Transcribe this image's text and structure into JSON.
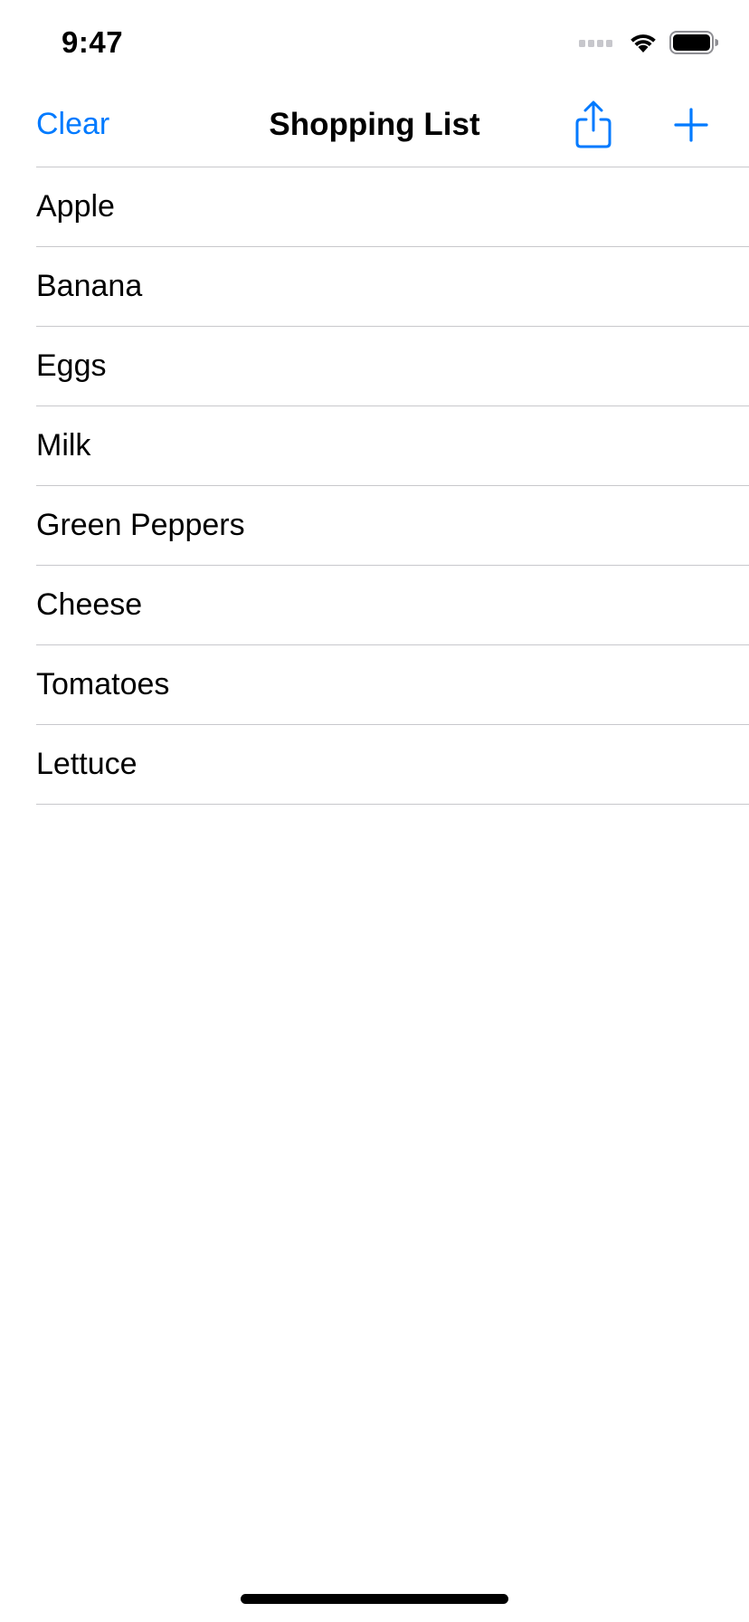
{
  "status_bar": {
    "time": "9:47"
  },
  "nav": {
    "clear_label": "Clear",
    "title": "Shopping List",
    "share_icon": "share-icon",
    "add_icon": "plus-icon"
  },
  "colors": {
    "accent": "#007aff",
    "separator": "#c8c8cc",
    "text": "#000000",
    "background": "#ffffff"
  },
  "items": [
    {
      "label": "Apple"
    },
    {
      "label": "Banana"
    },
    {
      "label": "Eggs"
    },
    {
      "label": "Milk"
    },
    {
      "label": "Green Peppers"
    },
    {
      "label": "Cheese"
    },
    {
      "label": "Tomatoes"
    },
    {
      "label": "Lettuce"
    }
  ]
}
